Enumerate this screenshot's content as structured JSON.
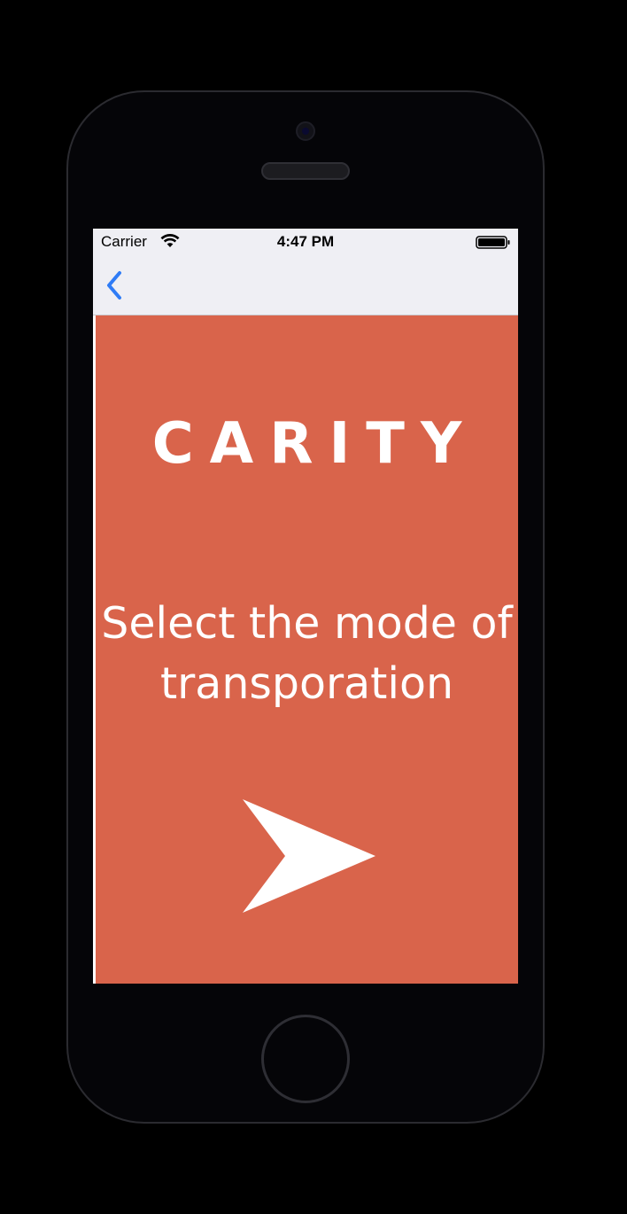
{
  "status_bar": {
    "carrier": "Carrier",
    "time": "4:47 PM",
    "wifi_icon": "wifi-icon",
    "battery_icon": "battery-full-icon"
  },
  "nav_bar": {
    "back_icon": "chevron-left-icon",
    "tint_color": "#2f7cf6"
  },
  "main": {
    "logo_text": "CARITY",
    "prompt": "Select the mode of transporation",
    "next_icon": "arrow-right-icon",
    "background_color": "#d9644b",
    "text_color": "#ffffff"
  },
  "device": {
    "home_button_icon": "home-button"
  }
}
